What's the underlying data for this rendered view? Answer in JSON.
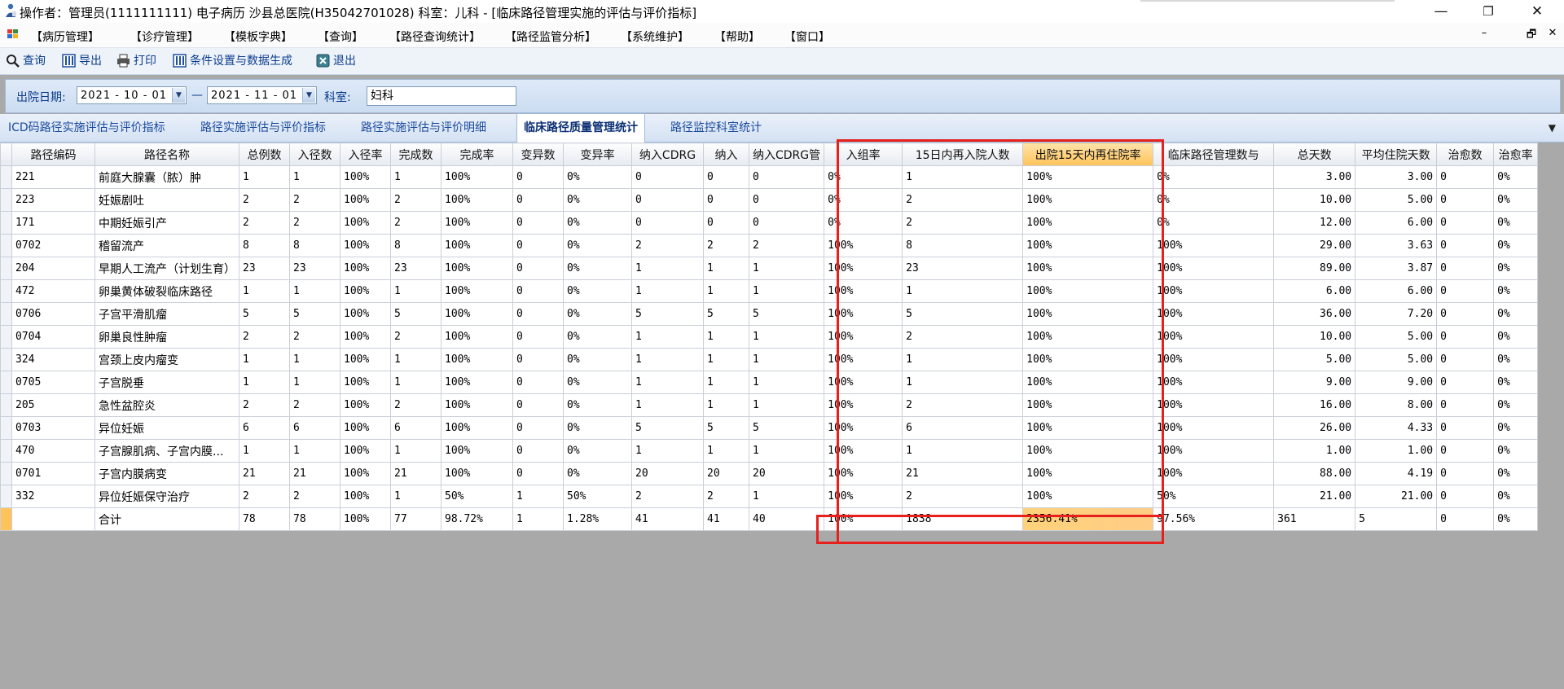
{
  "window": {
    "title": "操作者：管理员(1111111111) 电子病历  沙县总医院(H35042701028)  科室：儿科 - [临床路径管理实施的评估与评价指标]",
    "controls": [
      "—",
      "❐",
      "✕"
    ]
  },
  "menu": {
    "items": [
      "【病历管理】",
      "【诊疗管理】",
      "【模板字典】",
      "【查询】",
      "【路径查询统计】",
      "【路径监管分析】",
      "【系统维护】",
      "【帮助】",
      "【窗口】"
    ],
    "mdi_controls": [
      "–",
      "🗗",
      "✕"
    ]
  },
  "toolbar": {
    "buttons": [
      "查询",
      "导出",
      "打印",
      "条件设置与数据生成",
      "退出"
    ]
  },
  "filter": {
    "date_label": "出院日期:",
    "date_from": "2021 - 10 - 01",
    "separator": "—",
    "date_to": "2021 - 11 - 01",
    "dept_label": "科室:",
    "dept_value": "妇科"
  },
  "tabs": {
    "items": [
      "ICD码路径实施评估与评价指标",
      "路径实施评估与评价指标",
      "路径实施评估与评价明细",
      "临床路径质量管理统计",
      "路径监控科室统计"
    ],
    "active_index": 3,
    "overflow_icon": "dropdown-arrow-icon"
  },
  "table": {
    "columns": [
      "路径编码",
      "路径名称",
      "总例数",
      "入径数",
      "入径率",
      "完成数",
      "完成率",
      "变异数",
      "变异率",
      "纳入CDRG",
      "纳入",
      "纳入CDRG管",
      "入组率",
      "15日内再入院人数",
      "出院15天内再住院率",
      "临床路径管理数与",
      "总天数",
      "平均住院天数",
      "治愈数",
      "治愈率"
    ],
    "highlight_column": 14,
    "rows": [
      [
        "221",
        "前庭大腺囊（脓）肿",
        "1",
        "1",
        "100%",
        "1",
        "100%",
        "0",
        "0%",
        "0",
        "0",
        "0",
        "0%",
        "1",
        "100%",
        "0%",
        "3.00",
        "3.00",
        "0",
        "0%"
      ],
      [
        "223",
        "妊娠剧吐",
        "2",
        "2",
        "100%",
        "2",
        "100%",
        "0",
        "0%",
        "0",
        "0",
        "0",
        "0%",
        "2",
        "100%",
        "0%",
        "10.00",
        "5.00",
        "0",
        "0%"
      ],
      [
        "171",
        "中期妊娠引产",
        "2",
        "2",
        "100%",
        "2",
        "100%",
        "0",
        "0%",
        "0",
        "0",
        "0",
        "0%",
        "2",
        "100%",
        "0%",
        "12.00",
        "6.00",
        "0",
        "0%"
      ],
      [
        "0702",
        "稽留流产",
        "8",
        "8",
        "100%",
        "8",
        "100%",
        "0",
        "0%",
        "2",
        "2",
        "2",
        "100%",
        "8",
        "100%",
        "100%",
        "29.00",
        "3.63",
        "0",
        "0%"
      ],
      [
        "204",
        "早期人工流产（计划生育）",
        "23",
        "23",
        "100%",
        "23",
        "100%",
        "0",
        "0%",
        "1",
        "1",
        "1",
        "100%",
        "23",
        "100%",
        "100%",
        "89.00",
        "3.87",
        "0",
        "0%"
      ],
      [
        "472",
        "卵巢黄体破裂临床路径",
        "1",
        "1",
        "100%",
        "1",
        "100%",
        "0",
        "0%",
        "1",
        "1",
        "1",
        "100%",
        "1",
        "100%",
        "100%",
        "6.00",
        "6.00",
        "0",
        "0%"
      ],
      [
        "0706",
        "子宫平滑肌瘤",
        "5",
        "5",
        "100%",
        "5",
        "100%",
        "0",
        "0%",
        "5",
        "5",
        "5",
        "100%",
        "5",
        "100%",
        "100%",
        "36.00",
        "7.20",
        "0",
        "0%"
      ],
      [
        "0704",
        "卵巢良性肿瘤",
        "2",
        "2",
        "100%",
        "2",
        "100%",
        "0",
        "0%",
        "1",
        "1",
        "1",
        "100%",
        "2",
        "100%",
        "100%",
        "10.00",
        "5.00",
        "0",
        "0%"
      ],
      [
        "324",
        "宫颈上皮内瘤变",
        "1",
        "1",
        "100%",
        "1",
        "100%",
        "0",
        "0%",
        "1",
        "1",
        "1",
        "100%",
        "1",
        "100%",
        "100%",
        "5.00",
        "5.00",
        "0",
        "0%"
      ],
      [
        "0705",
        "子宫脱垂",
        "1",
        "1",
        "100%",
        "1",
        "100%",
        "0",
        "0%",
        "1",
        "1",
        "1",
        "100%",
        "1",
        "100%",
        "100%",
        "9.00",
        "9.00",
        "0",
        "0%"
      ],
      [
        "205",
        "急性盆腔炎",
        "2",
        "2",
        "100%",
        "2",
        "100%",
        "0",
        "0%",
        "1",
        "1",
        "1",
        "100%",
        "2",
        "100%",
        "100%",
        "16.00",
        "8.00",
        "0",
        "0%"
      ],
      [
        "0703",
        "异位妊娠",
        "6",
        "6",
        "100%",
        "6",
        "100%",
        "0",
        "0%",
        "5",
        "5",
        "5",
        "100%",
        "6",
        "100%",
        "100%",
        "26.00",
        "4.33",
        "0",
        "0%"
      ],
      [
        "470",
        "子宫腺肌病、子宫内膜...",
        "1",
        "1",
        "100%",
        "1",
        "100%",
        "0",
        "0%",
        "1",
        "1",
        "1",
        "100%",
        "1",
        "100%",
        "100%",
        "1.00",
        "1.00",
        "0",
        "0%"
      ],
      [
        "0701",
        "子宫内膜病变",
        "21",
        "21",
        "100%",
        "21",
        "100%",
        "0",
        "0%",
        "20",
        "20",
        "20",
        "100%",
        "21",
        "100%",
        "100%",
        "88.00",
        "4.19",
        "0",
        "0%"
      ],
      [
        "332",
        "异位妊娠保守治疗",
        "2",
        "2",
        "100%",
        "1",
        "50%",
        "1",
        "50%",
        "2",
        "2",
        "1",
        "100%",
        "2",
        "100%",
        "50%",
        "21.00",
        "21.00",
        "0",
        "0%"
      ]
    ],
    "total": [
      "",
      "合计",
      "78",
      "78",
      "100%",
      "77",
      "98.72%",
      "1",
      "1.28%",
      "41",
      "41",
      "40",
      "100%",
      "1838",
      "2356.41%",
      "97.56%",
      "361",
      "5",
      "0",
      "0%"
    ]
  },
  "colors": {
    "highlight_orange": "#ffc35a",
    "annotation_red": "#e8201c",
    "tab_text": "#1a4a9c"
  }
}
